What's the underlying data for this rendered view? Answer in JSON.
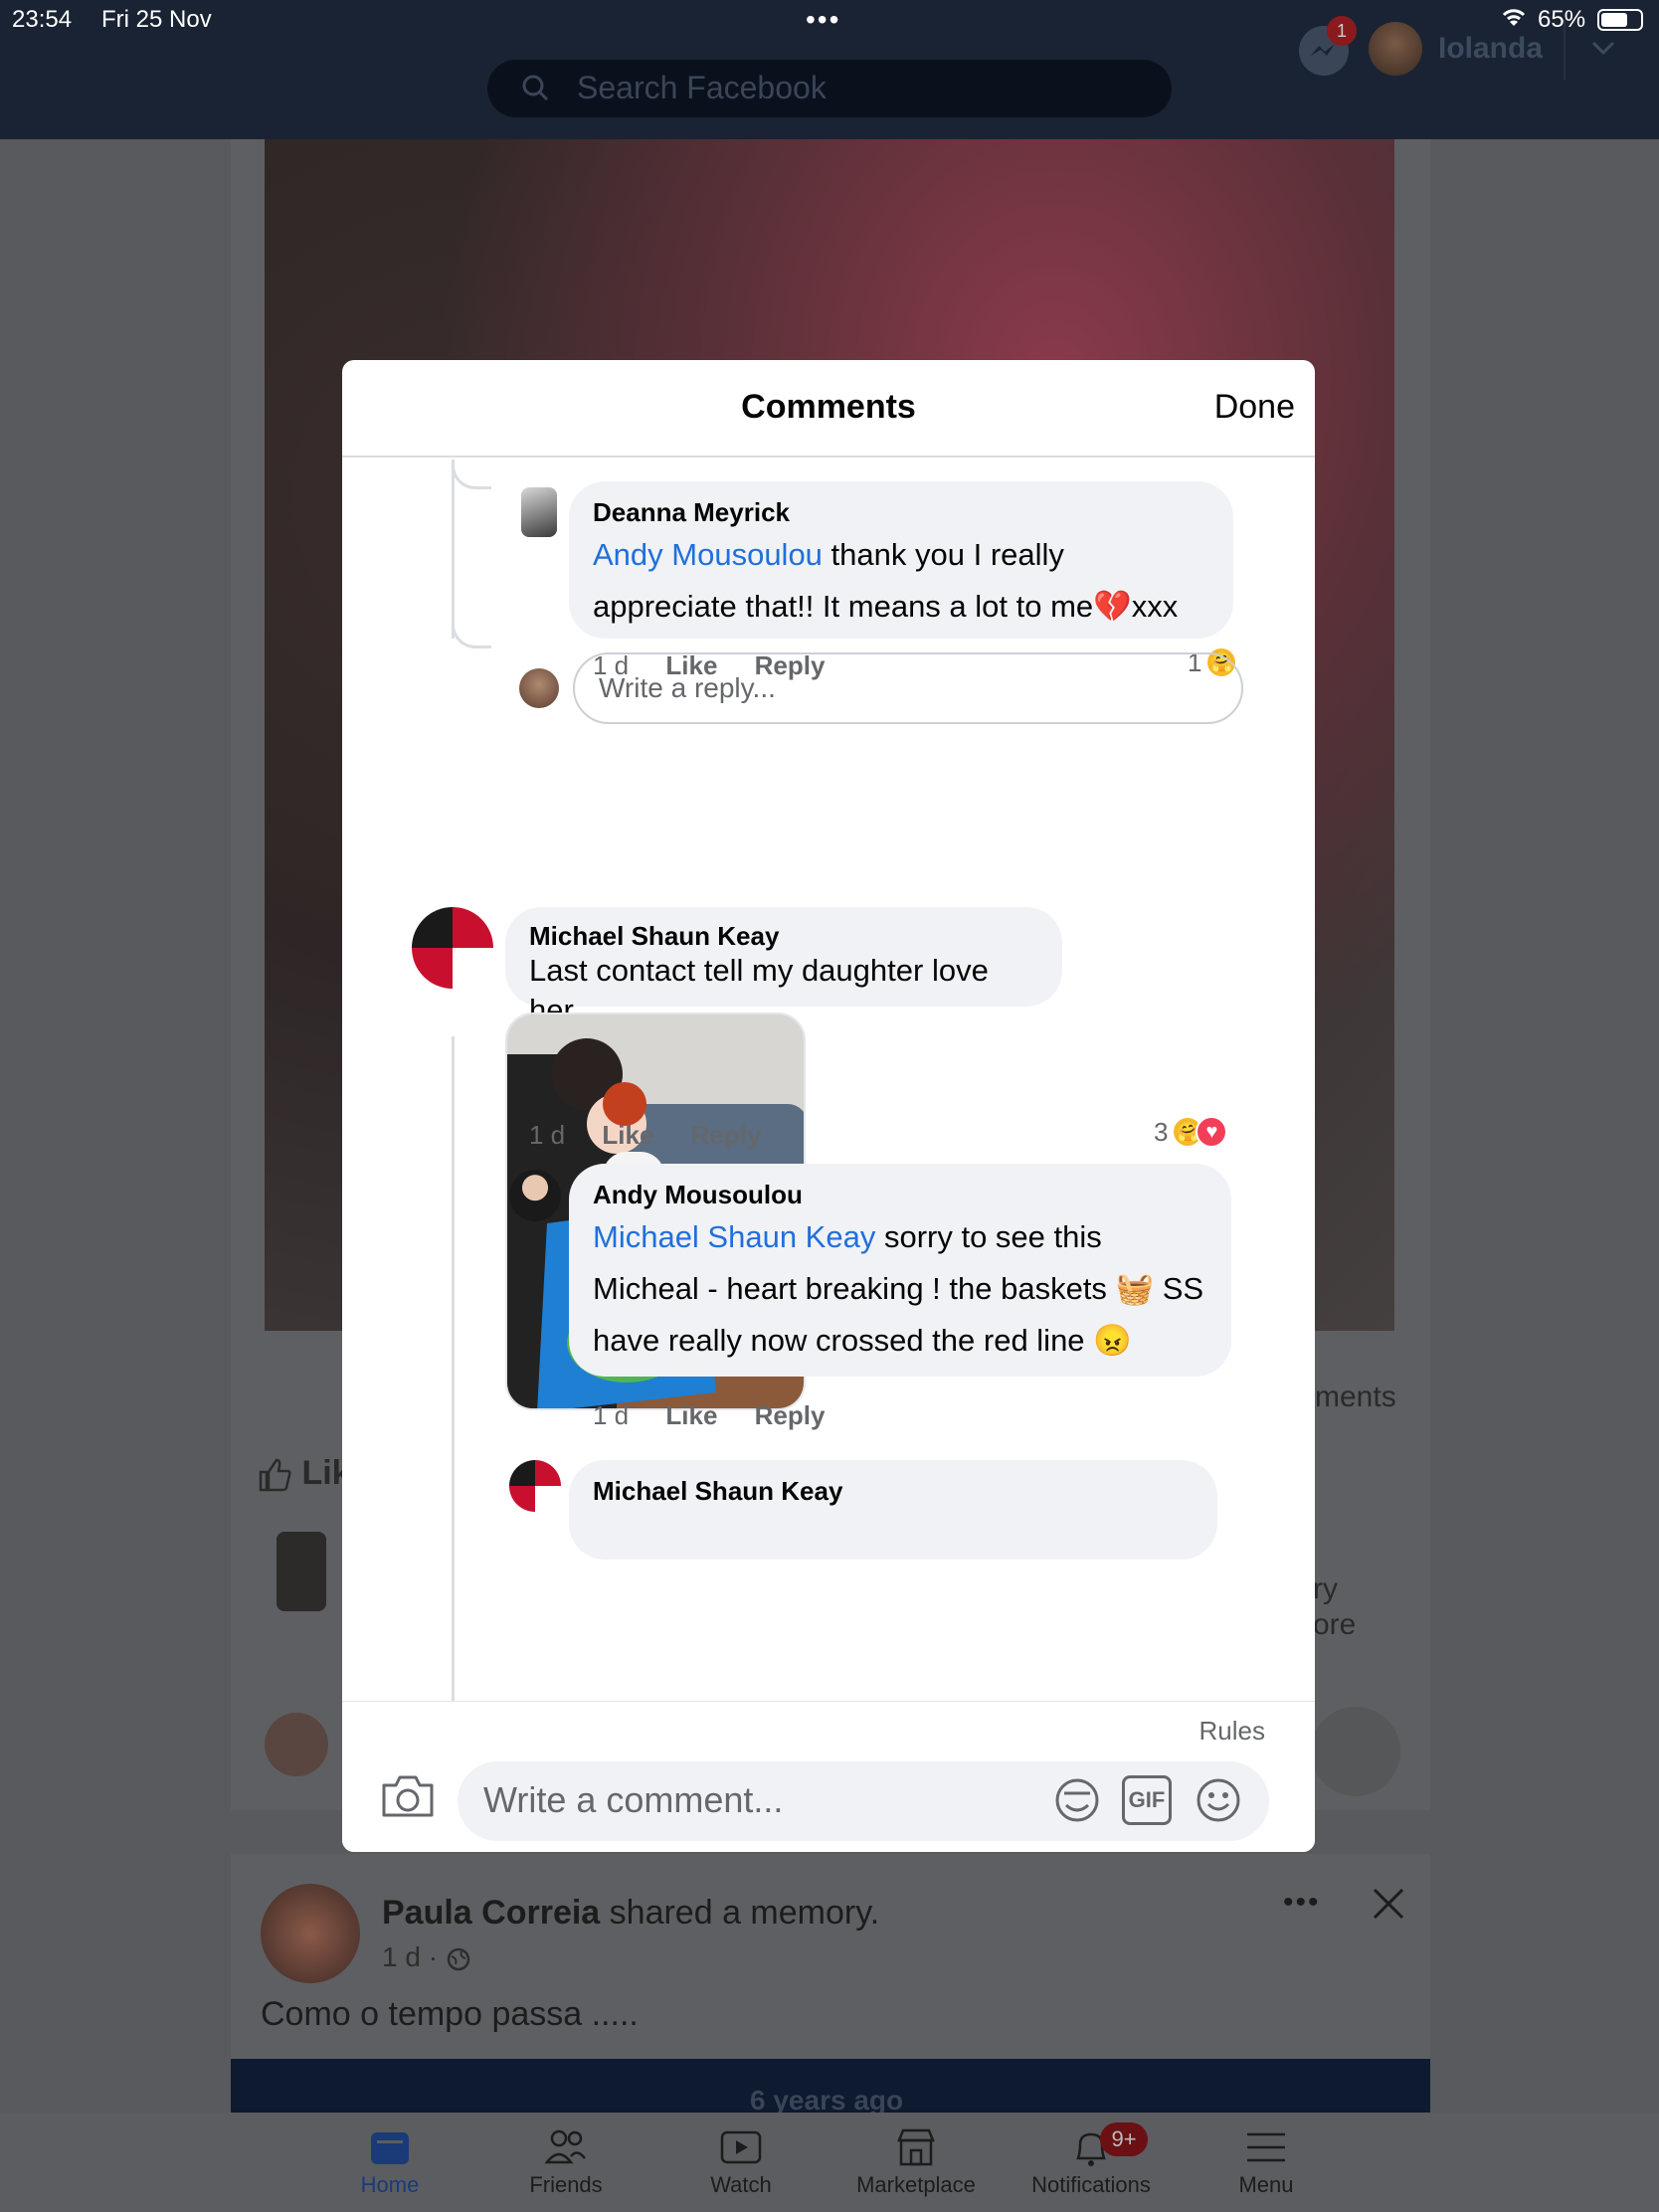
{
  "status_bar": {
    "time": "23:54",
    "date": "Fri 25 Nov",
    "dots": "•••",
    "battery": "65%"
  },
  "top_bar": {
    "search_placeholder": "Search Facebook",
    "messenger_badge": "1",
    "user_name": "Iolanda"
  },
  "background_post": {
    "like_label": "Lik",
    "comments_fragment": "ments",
    "side_text_1": "ry",
    "side_text_2": "ore"
  },
  "modal": {
    "title": "Comments",
    "done_label": "Done",
    "comments": [
      {
        "author": "Deanna Meyrick",
        "mention": "Andy Mousoulou",
        "text": " thank you I really appreciate that!! It means a lot to me💔xxx",
        "time": "1 d",
        "like": "Like",
        "reply": "Reply",
        "reaction_count": "1"
      },
      {
        "author": "Michael Shaun Keay",
        "text": "Last contact tell my daughter love her",
        "time": "1 d",
        "like": "Like",
        "reply": "Reply",
        "reaction_count": "3"
      },
      {
        "author": "Andy Mousoulou",
        "mention": "Michael Shaun Keay",
        "text": " sorry to see this Micheal - heart breaking ! the baskets 🧺 SS have really now crossed the red line 😠",
        "time": "1 d",
        "like": "Like",
        "reply": "Reply"
      },
      {
        "author": "Michael Shaun Keay"
      }
    ],
    "reply_placeholder": "Write a reply...",
    "rules_label": "Rules",
    "comment_placeholder": "Write a comment...",
    "gif_label": "GIF"
  },
  "memory_post": {
    "author": "Paula Correia",
    "action": " shared a memory.",
    "meta": "1 d · ",
    "text": "Como o tempo passa .....",
    "banner": "6 years ago"
  },
  "tabs": [
    {
      "label": "Home",
      "icon": "home-icon"
    },
    {
      "label": "Friends",
      "icon": "friends-icon"
    },
    {
      "label": "Watch",
      "icon": "watch-icon"
    },
    {
      "label": "Marketplace",
      "icon": "marketplace-icon"
    },
    {
      "label": "Notifications",
      "icon": "bell-icon",
      "badge": "9+"
    },
    {
      "label": "Menu",
      "icon": "menu-icon"
    }
  ],
  "colors": {
    "accent": "#216fdb",
    "bubble": "#f0f2f5",
    "muted": "#65676b"
  }
}
